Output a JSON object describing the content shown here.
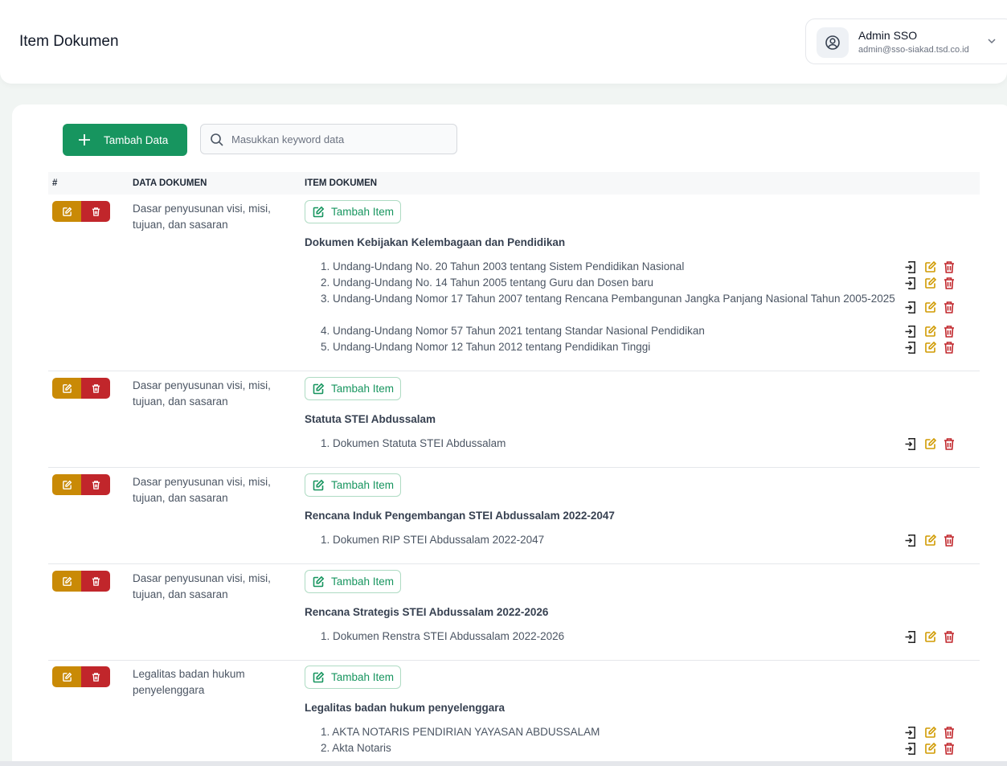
{
  "header": {
    "title": "Item Dokumen",
    "user_name": "Admin SSO",
    "user_email": "admin@sso-siakad.tsd.co.id"
  },
  "toolbar": {
    "add_label": "Tambah Data",
    "search_placeholder": "Masukkan keyword data"
  },
  "table": {
    "col_index": "#",
    "col_data": "DATA DOKUMEN",
    "col_item": "ITEM DOKUMEN",
    "add_item_label": "Tambah Item",
    "rows": [
      {
        "doc": "Dasar penyusunan visi, misi, tujuan, dan sasaran",
        "group": "Dokumen Kebijakan Kelembagaan dan Pendidikan",
        "items": [
          "1. Undang-Undang No. 20 Tahun 2003 tentang Sistem Pendidikan Nasional",
          "2. Undang-Undang No. 14 Tahun 2005 tentang Guru dan Dosen baru",
          "3. Undang-Undang Nomor 17 Tahun 2007 tentang Rencana Pembangunan Jangka Panjang Nasional Tahun 2005-2025",
          "4. Undang-Undang Nomor 57 Tahun 2021 tentang Standar Nasional Pendidikan",
          "5. Undang-Undang Nomor 12 Tahun 2012 tentang Pendidikan Tinggi"
        ]
      },
      {
        "doc": "Dasar penyusunan visi, misi, tujuan, dan sasaran",
        "group": "Statuta STEI Abdussalam",
        "items": [
          "1. Dokumen Statuta STEI Abdussalam"
        ]
      },
      {
        "doc": "Dasar penyusunan visi, misi, tujuan, dan sasaran",
        "group": "Rencana Induk Pengembangan STEI Abdussalam 2022-2047",
        "items": [
          "1. Dokumen RIP STEI Abdussalam 2022-2047"
        ]
      },
      {
        "doc": "Dasar penyusunan visi, misi, tujuan, dan sasaran",
        "group": "Rencana Strategis STEI Abdussalam 2022-2026",
        "items": [
          "1. Dokumen Renstra STEI Abdussalam 2022-2026"
        ]
      },
      {
        "doc": "Legalitas badan hukum penyelenggara",
        "group": "Legalitas badan hukum penyelenggara",
        "items": [
          "1. AKTA NOTARIS PENDIRIAN YAYASAN ABDUSSALAM",
          "2. Akta Notaris"
        ]
      }
    ]
  },
  "colors": {
    "primary": "#17955f",
    "edit": "#c98a06",
    "delete": "#c1262b"
  }
}
